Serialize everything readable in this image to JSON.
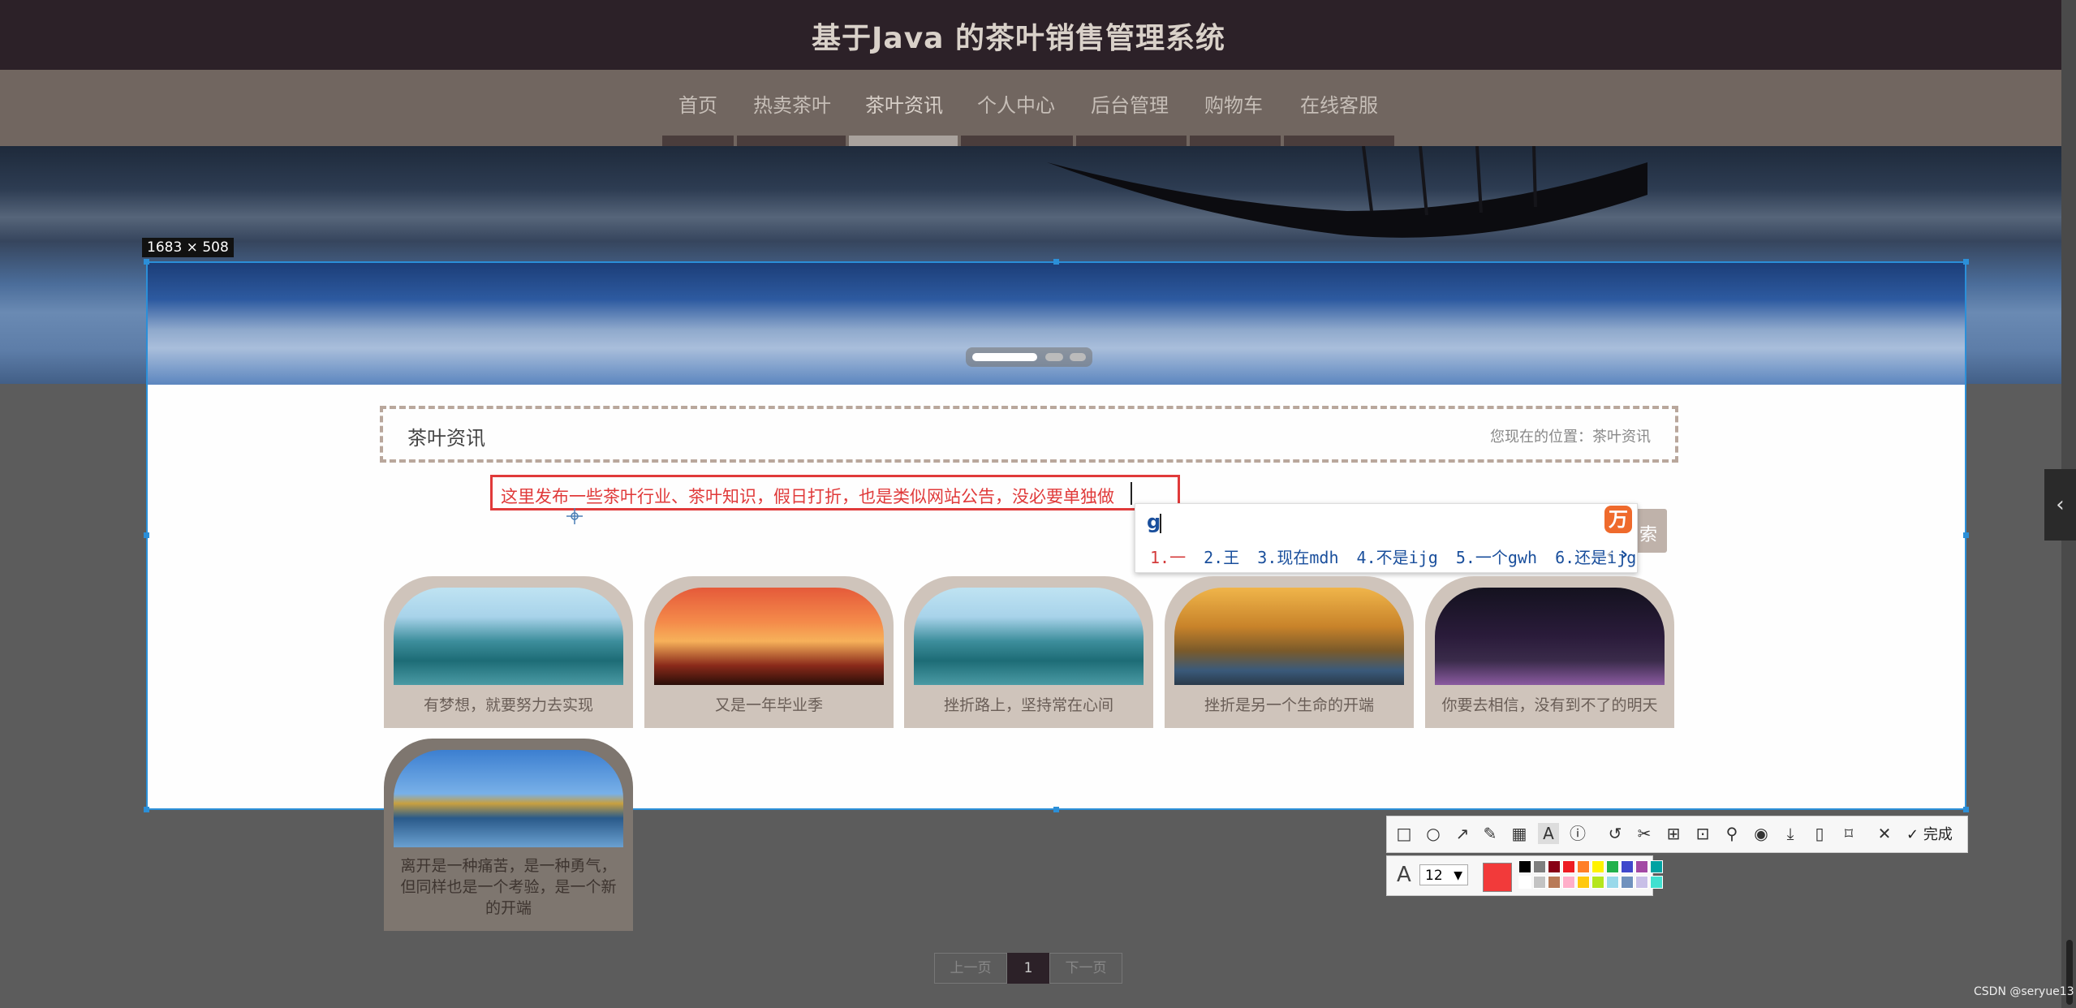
{
  "site": {
    "title": "基于Java 的茶叶销售管理系统",
    "nav": [
      "首页",
      "热卖茶叶",
      "茶叶资讯",
      "个人中心",
      "后台管理",
      "购物车",
      "在线客服"
    ],
    "active_nav_index": 2
  },
  "screenshot_tool": {
    "size_label": "1683 × 508",
    "toolbar": {
      "icons": [
        "rectangle-icon",
        "ellipse-icon",
        "arrow-icon",
        "pen-icon",
        "mosaic-icon",
        "text-icon",
        "number-icon",
        "undo-icon",
        "scissors-icon",
        "translate-icon",
        "ocr-icon",
        "pin-icon",
        "record-icon",
        "download-icon",
        "save-device-icon",
        "bookmark-icon",
        "close-icon",
        "check-icon"
      ],
      "done_label": "完成"
    },
    "style": {
      "font_size": "12",
      "current_color": "#f23a3a",
      "palette": [
        "#000000",
        "#7f7f7f",
        "#880015",
        "#ed1c24",
        "#ff7f27",
        "#fff200",
        "#22b14c",
        "#3f48cc",
        "#a349a4",
        "#00a2a2",
        "#ffffff",
        "#c3c3c3",
        "#b97a57",
        "#ffaec9",
        "#ffc90e",
        "#b5e61d",
        "#99d9ea",
        "#7092be",
        "#c8bfe7",
        "#40e0d0"
      ]
    },
    "annotation_text": "这里发布一些茶叶行业、茶叶知识，假日打折，也是类似网站公告，没必要单独做"
  },
  "ime": {
    "input": "g",
    "candidates": [
      "1.一",
      "2.王",
      "3.现在mdh",
      "4.不是ijg",
      "5.一个gwh",
      "6.还是ijg"
    ]
  },
  "section": {
    "title": "茶叶资讯",
    "location": "您现在的位置：茶叶资讯",
    "search_label": "索"
  },
  "articles": [
    {
      "caption": "有梦想，就要努力去实现",
      "image": "lake"
    },
    {
      "caption": "又是一年毕业季",
      "image": "sunset"
    },
    {
      "caption": "挫折路上，坚持常在心间",
      "image": "lake"
    },
    {
      "caption": "挫折是另一个生命的开端",
      "image": "road"
    },
    {
      "caption": "你要去相信，没有到不了的明天",
      "image": "night"
    },
    {
      "caption_lines": [
        "离开是一种痛苦，是一种勇气，",
        "但同样也是一个考验，是一个新",
        "的开端"
      ],
      "image": "tree"
    }
  ],
  "pagination": {
    "prev": "上一页",
    "current": "1",
    "next": "下一页"
  },
  "watermark": "CSDN @seryue13"
}
